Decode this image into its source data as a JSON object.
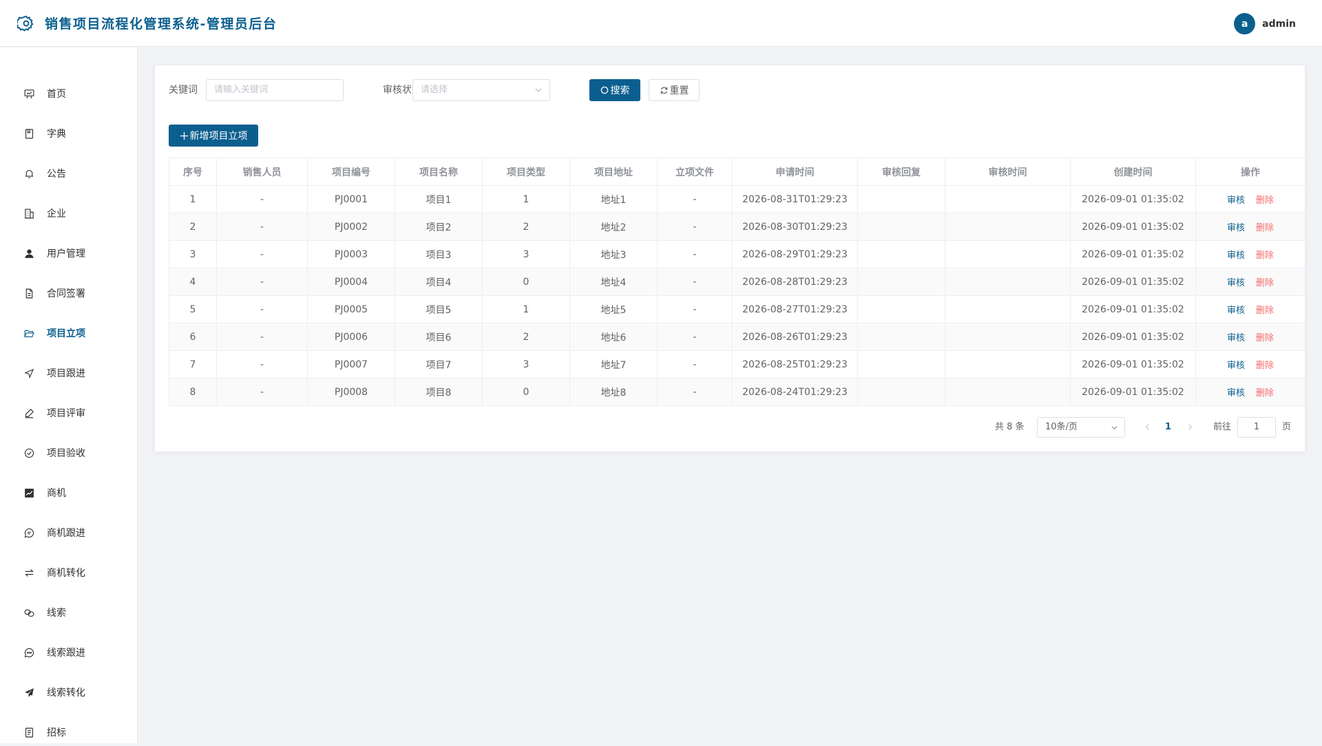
{
  "header": {
    "title": "销售项目流程化管理系统-管理员后台",
    "avatar_letter": "a",
    "username": "admin"
  },
  "sidebar": {
    "active": "项目立项",
    "items": [
      {
        "label": "首页",
        "icon": "chart-board-icon"
      },
      {
        "label": "字典",
        "icon": "book-icon"
      },
      {
        "label": "公告",
        "icon": "bell-icon"
      },
      {
        "label": "企业",
        "icon": "office-building-icon"
      },
      {
        "label": "用户管理",
        "icon": "user-icon"
      },
      {
        "label": "合同签署",
        "icon": "document-icon"
      },
      {
        "label": "项目立项",
        "icon": "folder-open-icon"
      },
      {
        "label": "项目跟进",
        "icon": "position-arrow-icon"
      },
      {
        "label": "项目评审",
        "icon": "edit-pen-icon"
      },
      {
        "label": "项目验收",
        "icon": "circle-check-icon"
      },
      {
        "label": "商机",
        "icon": "data-line-icon"
      },
      {
        "label": "商机跟进",
        "icon": "chat-line-icon"
      },
      {
        "label": "商机转化",
        "icon": "switch-icon"
      },
      {
        "label": "线索",
        "icon": "link-icon"
      },
      {
        "label": "线索跟进",
        "icon": "chat-dots-icon"
      },
      {
        "label": "线索转化",
        "icon": "send-icon"
      },
      {
        "label": "招标",
        "icon": "tickets-icon"
      }
    ]
  },
  "search": {
    "keyword_label": "关键词",
    "keyword_placeholder": "请输入关键词",
    "status_label": "审核状态",
    "status_placeholder": "请选择",
    "search_button": "搜索",
    "reset_button": "重置"
  },
  "add_button": "新增项目立项",
  "table": {
    "columns": [
      "序号",
      "销售人员",
      "项目编号",
      "项目名称",
      "项目类型",
      "项目地址",
      "立项文件",
      "申请时间",
      "审核回复",
      "审核时间",
      "创建时间",
      "操作"
    ],
    "rows": [
      [
        "1",
        "-",
        "PJ0001",
        "项目1",
        "1",
        "地址1",
        "-",
        "2026-08-31T01:29:23",
        "",
        "",
        "2026-09-01 01:35:02"
      ],
      [
        "2",
        "-",
        "PJ0002",
        "项目2",
        "2",
        "地址2",
        "-",
        "2026-08-30T01:29:23",
        "",
        "",
        "2026-09-01 01:35:02"
      ],
      [
        "3",
        "-",
        "PJ0003",
        "项目3",
        "3",
        "地址3",
        "-",
        "2026-08-29T01:29:23",
        "",
        "",
        "2026-09-01 01:35:02"
      ],
      [
        "4",
        "-",
        "PJ0004",
        "项目4",
        "0",
        "地址4",
        "-",
        "2026-08-28T01:29:23",
        "",
        "",
        "2026-09-01 01:35:02"
      ],
      [
        "5",
        "-",
        "PJ0005",
        "项目5",
        "1",
        "地址5",
        "-",
        "2026-08-27T01:29:23",
        "",
        "",
        "2026-09-01 01:35:02"
      ],
      [
        "6",
        "-",
        "PJ0006",
        "项目6",
        "2",
        "地址6",
        "-",
        "2026-08-26T01:29:23",
        "",
        "",
        "2026-09-01 01:35:02"
      ],
      [
        "7",
        "-",
        "PJ0007",
        "项目7",
        "3",
        "地址7",
        "-",
        "2026-08-25T01:29:23",
        "",
        "",
        "2026-09-01 01:35:02"
      ],
      [
        "8",
        "-",
        "PJ0008",
        "项目8",
        "0",
        "地址8",
        "-",
        "2026-08-24T01:29:23",
        "",
        "",
        "2026-09-01 01:35:02"
      ]
    ],
    "actions": {
      "audit": "审核",
      "delete": "删除"
    }
  },
  "pagination": {
    "total_text": "共 8 条",
    "page_size": "10条/页",
    "current_page": "1",
    "goto_label": "前往",
    "goto_value": "1",
    "page_suffix": "页"
  },
  "colors": {
    "primary": "#0b5f8f",
    "danger": "#f56c6c",
    "background": "#f2f3f5"
  }
}
